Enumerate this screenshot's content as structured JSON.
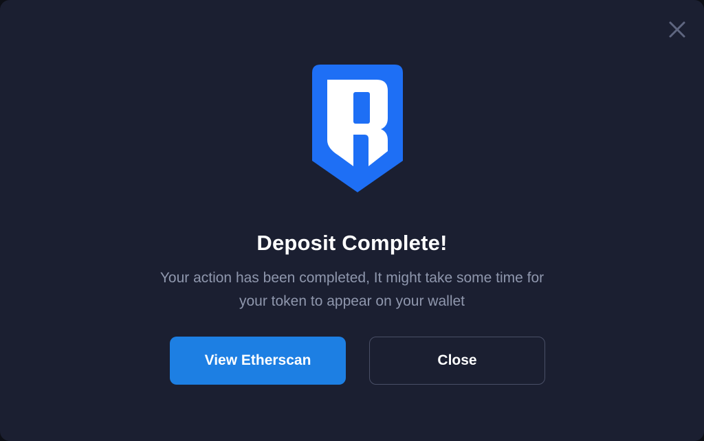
{
  "dialog": {
    "title": "Deposit Complete!",
    "message": "Your action has been completed, It might take some time for your token to appear on your wallet",
    "close_icon": "close-icon",
    "logo_icon": "ronin-logo-icon"
  },
  "actions": {
    "primary_label": "View Etherscan",
    "secondary_label": "Close"
  },
  "colors": {
    "background": "#1b1f31",
    "accent": "#1d7fe3",
    "logo_blue": "#1e6ff5",
    "text_primary": "#ffffff",
    "text_secondary": "#8f97ad"
  }
}
